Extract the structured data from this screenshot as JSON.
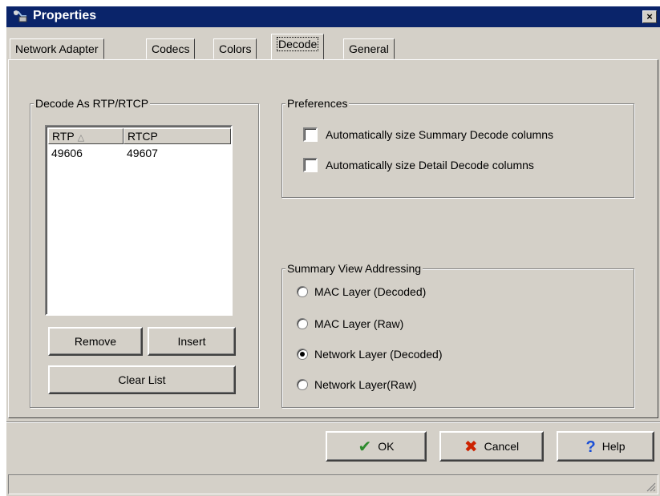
{
  "window": {
    "title": "Properties",
    "close_label": "×"
  },
  "tabs": [
    {
      "label": "Network Adapter"
    },
    {
      "label": "Codecs"
    },
    {
      "label": "Colors"
    },
    {
      "label": "Decode"
    },
    {
      "label": "General"
    }
  ],
  "decode_group": {
    "title": "Decode As RTP/RTCP",
    "columns": [
      "RTP",
      "RTCP"
    ],
    "rows": [
      {
        "rtp": "49606",
        "rtcp": "49607"
      }
    ],
    "remove_label": "Remove",
    "insert_label": "Insert",
    "clear_label": "Clear List"
  },
  "preferences_group": {
    "title": "Preferences",
    "options": [
      {
        "label": "Automatically size Summary Decode columns",
        "checked": false
      },
      {
        "label": "Automatically size Detail Decode columns",
        "checked": false
      }
    ]
  },
  "addressing_group": {
    "title": "Summary View Addressing",
    "options": [
      {
        "label": "MAC Layer (Decoded)",
        "selected": false
      },
      {
        "label": "MAC Layer (Raw)",
        "selected": false
      },
      {
        "label": "Network Layer (Decoded)",
        "selected": true
      },
      {
        "label": "Network Layer(Raw)",
        "selected": false
      }
    ]
  },
  "buttons": {
    "ok": "OK",
    "cancel": "Cancel",
    "help": "Help"
  },
  "colors": {
    "titlebar": "#0a246a",
    "face": "#d4d0c8",
    "ok_check": "#2e8b2e",
    "cancel_x": "#cc2200",
    "help_q": "#1a4fd6"
  }
}
